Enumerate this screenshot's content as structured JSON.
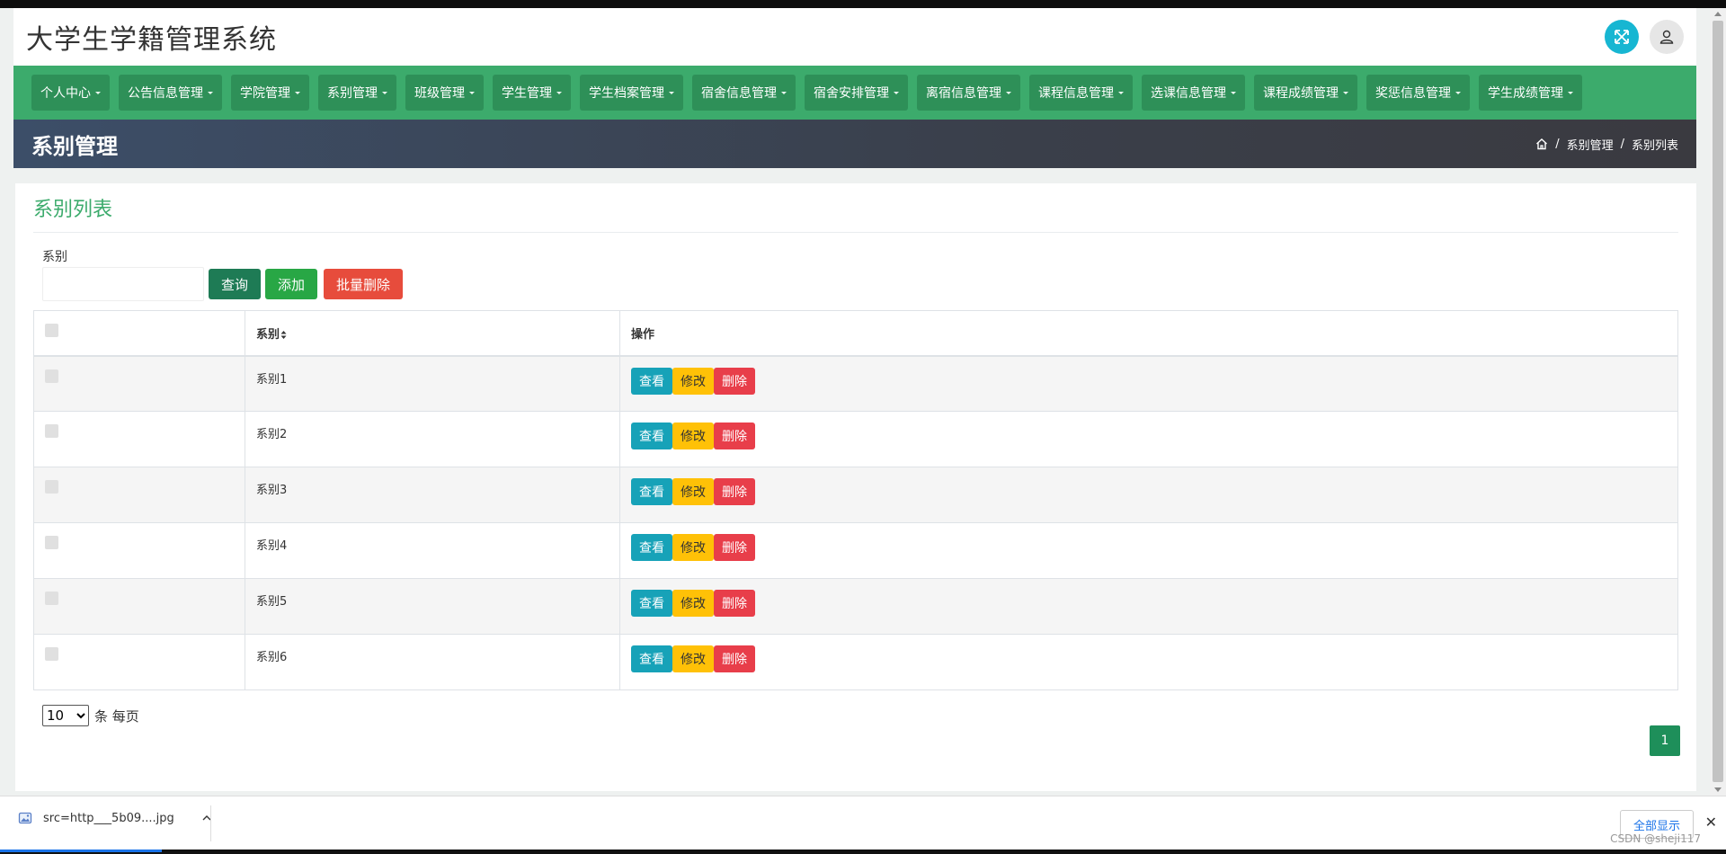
{
  "header": {
    "title": "大学生学籍管理系统"
  },
  "nav": [
    "个人中心",
    "公告信息管理",
    "学院管理",
    "系别管理",
    "班级管理",
    "学生管理",
    "学生档案管理",
    "宿舍信息管理",
    "宿舍安排管理",
    "离宿信息管理",
    "课程信息管理",
    "选课信息管理",
    "课程成绩管理",
    "奖惩信息管理",
    "学生成绩管理"
  ],
  "page_header": {
    "title": "系别管理",
    "breadcrumb": [
      "系别管理",
      "系别列表"
    ]
  },
  "card": {
    "title": "系别列表"
  },
  "filter": {
    "label": "系别",
    "value": "",
    "search_label": "查询",
    "add_label": "添加",
    "batch_delete_label": "批量删除"
  },
  "table": {
    "columns": [
      "系别",
      "操作"
    ],
    "rows": [
      {
        "name": "系别1"
      },
      {
        "name": "系别2"
      },
      {
        "name": "系别3"
      },
      {
        "name": "系别4"
      },
      {
        "name": "系别5"
      },
      {
        "name": "系别6"
      }
    ],
    "actions": {
      "view": "查看",
      "edit": "修改",
      "delete": "删除"
    }
  },
  "pagination": {
    "page_size": "10",
    "page_size_options": [
      "10"
    ],
    "per_page_label": "条 每页",
    "current_page": "1"
  },
  "download_bar": {
    "filename": "src=http___5b09....jpg",
    "show_all": "全部显示",
    "watermark": "CSDN @sheji117"
  },
  "colors": {
    "nav_bg": "#3cab6c",
    "nav_item_bg": "#2e9058",
    "accent_green": "#3cab6c",
    "view": "#17a2b8",
    "edit": "#ffc107",
    "delete": "#e83e4a"
  }
}
